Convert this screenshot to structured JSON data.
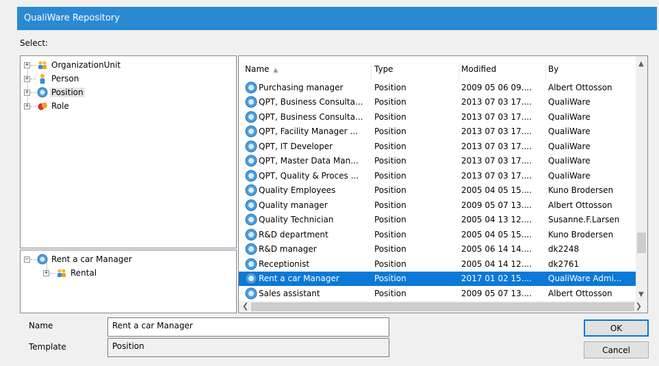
{
  "window": {
    "title": "QualiWare Repository"
  },
  "select_label": "Select:",
  "tree_top": {
    "items": [
      {
        "label": "OrganizationUnit",
        "icon": "organization-unit-icon"
      },
      {
        "label": "Person",
        "icon": "person-icon"
      },
      {
        "label": "Position",
        "icon": "position-icon",
        "selected": true
      },
      {
        "label": "Role",
        "icon": "role-icon"
      }
    ]
  },
  "tree_bottom": {
    "root": {
      "label": "Rent a car Manager",
      "icon": "position-icon"
    },
    "child": {
      "label": "Rental",
      "icon": "organization-unit-icon"
    }
  },
  "list": {
    "columns": [
      "Name",
      "Type",
      "Modified",
      "By"
    ],
    "rows": [
      {
        "name": "Purchasing manager",
        "type": "Position",
        "modified": "2009 05 06 09....",
        "by": "Albert Ottosson"
      },
      {
        "name": "QPT, Business Consulta...",
        "type": "Position",
        "modified": "2013 07 03 17....",
        "by": "QualiWare"
      },
      {
        "name": "QPT, Business Consulta...",
        "type": "Position",
        "modified": "2013 07 03 17....",
        "by": "QualiWare"
      },
      {
        "name": "QPT, Facility Manager ...",
        "type": "Position",
        "modified": "2013 07 03 17....",
        "by": "QualiWare"
      },
      {
        "name": "QPT, IT Developer",
        "type": "Position",
        "modified": "2013 07 03 17....",
        "by": "QualiWare"
      },
      {
        "name": "QPT, Master Data Man...",
        "type": "Position",
        "modified": "2013 07 03 17....",
        "by": "QualiWare"
      },
      {
        "name": "QPT, Quality & Proces ...",
        "type": "Position",
        "modified": "2013 07 03 17....",
        "by": "QualiWare"
      },
      {
        "name": "Quality Employees",
        "type": "Position",
        "modified": "2005 04 05 15....",
        "by": "Kuno Brodersen"
      },
      {
        "name": "Quality manager",
        "type": "Position",
        "modified": "2009 05 07 13....",
        "by": "Albert Ottosson"
      },
      {
        "name": "Quality Technician",
        "type": "Position",
        "modified": "2005 04 13 12....",
        "by": "Susanne.F.Larsen"
      },
      {
        "name": "R&D department",
        "type": "Position",
        "modified": "2005 04 05 15....",
        "by": "Kuno Brodersen"
      },
      {
        "name": "R&D manager",
        "type": "Position",
        "modified": "2005 06 14 14....",
        "by": "dk2248"
      },
      {
        "name": "Receptionist",
        "type": "Position",
        "modified": "2005 04 14 12....",
        "by": "dk2761"
      },
      {
        "name": "Rent a car Manager",
        "type": "Position",
        "modified": "2017 01 02 15....",
        "by": "QualiWare Admi...",
        "selected": true
      },
      {
        "name": "Sales assistant",
        "type": "Position",
        "modified": "2009 05 07 13....",
        "by": "Albert Ottosson"
      }
    ]
  },
  "fields": {
    "name_label": "Name",
    "name_value": "Rent a car Manager",
    "template_label": "Template",
    "template_value": "Position"
  },
  "buttons": {
    "ok": "OK",
    "cancel": "Cancel"
  },
  "colors": {
    "title_bar": "#2a89d3",
    "selection": "#0b79d8",
    "position_icon": "#4a9fe0"
  }
}
